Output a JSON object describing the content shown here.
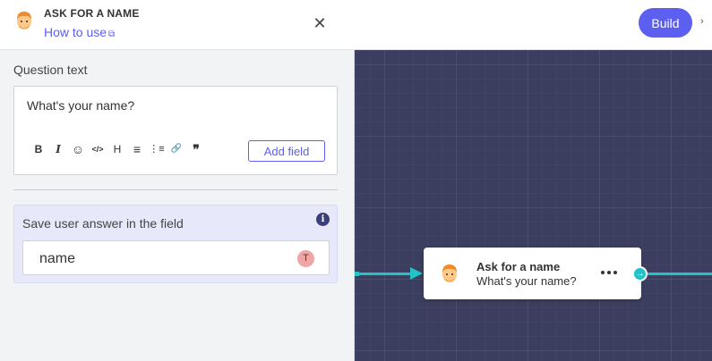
{
  "topbar": {
    "build_label": "Build",
    "chevron": "›"
  },
  "panel": {
    "title": "ASK FOR A NAME",
    "how_to_use": "How to use",
    "external_icon": "⧉",
    "close_icon": "✕",
    "question_label": "Question text",
    "question_text": "What's your name?",
    "toolbar": [
      {
        "name": "bold-icon",
        "glyph": "B"
      },
      {
        "name": "italic-icon",
        "glyph": "I"
      },
      {
        "name": "emoji-icon",
        "glyph": "☺"
      },
      {
        "name": "code-icon",
        "glyph": "</>"
      },
      {
        "name": "heading-icon",
        "glyph": "H"
      },
      {
        "name": "ordered-list-icon",
        "glyph": "≡"
      },
      {
        "name": "bullet-list-icon",
        "glyph": "⋮≡"
      },
      {
        "name": "link-icon",
        "glyph": "🔗"
      },
      {
        "name": "quote-icon",
        "glyph": "❞"
      }
    ],
    "add_field_label": "Add field",
    "save_label": "Save user answer in the field",
    "info_icon": "i",
    "field_value": "name",
    "field_badge": "T"
  },
  "node": {
    "title": "Ask for a name",
    "subtitle": "What's your name?",
    "out_arrow": "→"
  },
  "colors": {
    "accent": "#5d5ff0",
    "connector": "#22c3c6",
    "canvas": "#3b3e5e"
  }
}
